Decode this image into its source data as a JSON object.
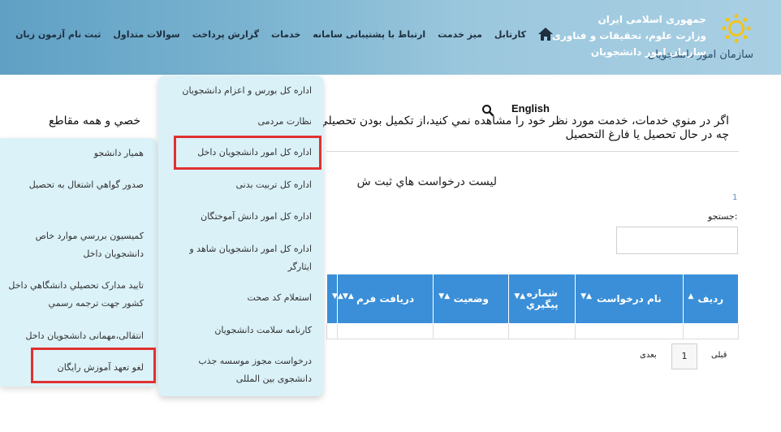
{
  "header": {
    "logo_lines": [
      "جمهوری اسلامی ایران",
      "وزارت علوم، تحقیقات و فناوری",
      "سازمان امور دانشجویان"
    ],
    "logo_small": "سازمان امور دانشجویان"
  },
  "nav": {
    "items": [
      "کارتابل",
      "میز خدمت",
      "ارتباط با پشتیبانی سامانه",
      "خدمات",
      "گزارش پرداخت",
      "سوالات متداول",
      "ثبت نام آزمون زبان"
    ]
  },
  "page": {
    "english_link": "English",
    "message": "اگر در منوي خدمات، خدمت مورد نظر خود را مشاهده نمي کنيد،از تکميل بودن تحصيلي- چه در حال تحصيل يا فارغ التحصيل",
    "left_heading": "خصي و همه مقاطع",
    "list_title": "ليست درخواست هاي ثبت ش",
    "count": "1",
    "search_label": "جستجو:"
  },
  "table": {
    "headers": [
      "رديف",
      "نام درخواست",
      "شماره پيگيري",
      "وضعيت",
      "دريافت فرم",
      ""
    ]
  },
  "pager": {
    "next": "قبلی",
    "page": "1",
    "prev": "بعدی"
  },
  "menu": {
    "items": [
      "اداره کل بورس و اعزام دانشجويان",
      "نظارت مردمی",
      "اداره کل امور دانشجويان داخل",
      "اداره کل تربيت بدنی",
      "اداره کل امور دانش آموختگان",
      "اداره کل امور دانشجويان شاهد و ايثارگر",
      "استعلام کد صحت",
      "کارنامه سلامت دانشجويان",
      "درخواست مجوز موسسه جذب دانشجوی بين المللی"
    ]
  },
  "submenu": {
    "items": [
      "همیار دانشجو",
      "صدور گواهي اشتغال به تحصيل",
      "کميسيون بررسي موارد خاص دانشجويان داخل",
      "تاييد مدارک تحصيلي دانشگاهي داخل کشور جهت ترجمه رسمي",
      "انتقالی،مهمانی دانشجويان داخل",
      "لغو تعهد آموزش رايگان"
    ]
  },
  "colors": {
    "highlight": "#e03131",
    "table_header": "#3a8fd8",
    "menu_bg": "#daf1f8"
  }
}
